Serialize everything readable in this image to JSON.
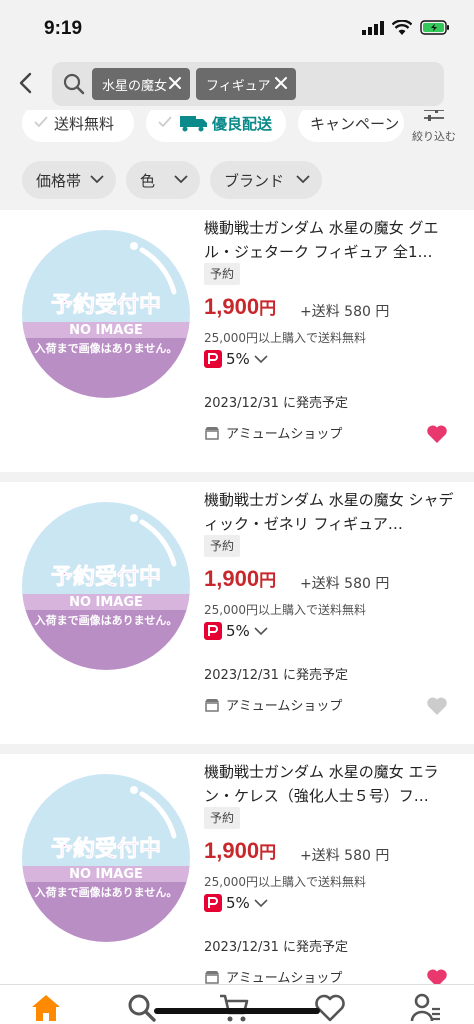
{
  "status": {
    "time": "9:19"
  },
  "search": {
    "chips": [
      {
        "label": "水星の魔女"
      },
      {
        "label": "フィギュア"
      }
    ]
  },
  "filters": {
    "row1": [
      {
        "label": "送料無料"
      },
      {
        "label": "優良配送"
      },
      {
        "label": "キャンペーン"
      }
    ],
    "narrow_label": "絞り込む",
    "row2": [
      {
        "label": "価格帯"
      },
      {
        "label": "色"
      },
      {
        "label": "ブランド"
      }
    ]
  },
  "products": [
    {
      "title": "機動戦士ガンダム 水星の魔女 グエル・ジェターク フィギュア 全1…",
      "badge": "予約",
      "price": "1,900",
      "price_unit": "円",
      "shipping": "+送料 580 円",
      "free_ship_note": "25,000円以上購入で送料無料",
      "points": "5%",
      "release": "2023/12/31 に発売予定",
      "shop": "アミュームショップ",
      "favorited": true,
      "thumb_text": {
        "line1": "予約受付中",
        "line2": "NO IMAGE",
        "line3": "入荷まで画像はありません。"
      }
    },
    {
      "title": "機動戦士ガンダム 水星の魔女 シャディック・ゼネリ フィギュア…",
      "badge": "予約",
      "price": "1,900",
      "price_unit": "円",
      "shipping": "+送料 580 円",
      "free_ship_note": "25,000円以上購入で送料無料",
      "points": "5%",
      "release": "2023/12/31 に発売予定",
      "shop": "アミュームショップ",
      "favorited": false,
      "thumb_text": {
        "line1": "予約受付中",
        "line2": "NO IMAGE",
        "line3": "入荷まで画像はありません。"
      }
    },
    {
      "title": "機動戦士ガンダム 水星の魔女 エラン・ケレス（強化人士５号）フ…",
      "badge": "予約",
      "price": "1,900",
      "price_unit": "円",
      "shipping": "+送料 580 円",
      "free_ship_note": "25,000円以上購入で送料無料",
      "points": "5%",
      "release": "2023/12/31 に発売予定",
      "shop": "アミュームショップ",
      "favorited": true,
      "thumb_text": {
        "line1": "予約受付中",
        "line2": "NO IMAGE",
        "line3": "入荷まで画像はありません。"
      }
    }
  ],
  "colors": {
    "price": "#c8282d",
    "favorite_active": "#e8386d",
    "favorite_inactive": "#cccccc",
    "home_active": "#ff8a00",
    "delivery_teal": "#0a8a8a",
    "paypay_red": "#e60033"
  },
  "tabbar": {
    "items": [
      {
        "icon": "home-icon"
      },
      {
        "icon": "search-icon"
      },
      {
        "icon": "cart-icon"
      },
      {
        "icon": "heart-icon"
      },
      {
        "icon": "account-icon"
      }
    ]
  }
}
